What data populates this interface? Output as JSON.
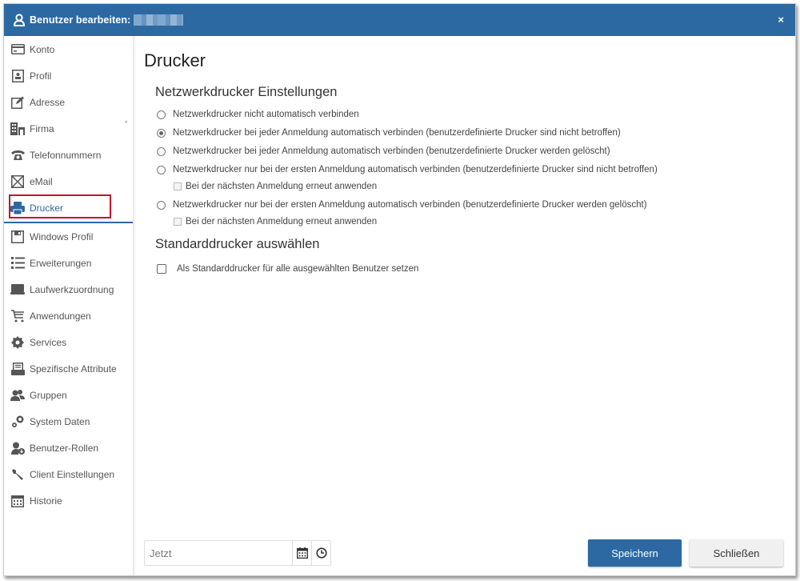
{
  "window": {
    "title": "Benutzer bearbeiten:",
    "title_icon": "user-icon",
    "close_label": "×"
  },
  "sidebar": {
    "items": [
      {
        "label": "Konto",
        "icon": "credit-card-icon"
      },
      {
        "label": "Profil",
        "icon": "profile-card-icon"
      },
      {
        "label": "Adresse",
        "icon": "edit-icon"
      },
      {
        "label": "Firma",
        "icon": "building-icon"
      },
      {
        "label": "Telefonnummern",
        "icon": "phone-icon"
      },
      {
        "label": "eMail",
        "icon": "envelope-icon"
      },
      {
        "label": "Drucker",
        "icon": "printer-icon",
        "active": true
      },
      {
        "label": "Windows Profil",
        "icon": "floppy-disk-icon"
      },
      {
        "label": "Erweiterungen",
        "icon": "list-icon"
      },
      {
        "label": "Laufwerkzuordnung",
        "icon": "drive-icon"
      },
      {
        "label": "Anwendungen",
        "icon": "cart-icon"
      },
      {
        "label": "Services",
        "icon": "gear-icon"
      },
      {
        "label": "Spezifische Attribute",
        "icon": "inbox-icon"
      },
      {
        "label": "Gruppen",
        "icon": "group-icon"
      },
      {
        "label": "System Daten",
        "icon": "gears-icon"
      },
      {
        "label": "Benutzer-Rollen",
        "icon": "user-role-icon"
      },
      {
        "label": "Client Einstellungen",
        "icon": "wrench-icon"
      },
      {
        "label": "Historie",
        "icon": "calendar-icon"
      }
    ],
    "firma_marker": "*"
  },
  "main": {
    "page_title": "Drucker",
    "network_section": {
      "title": "Netzwerkdrucker Einstellungen",
      "options": [
        {
          "label": "Netzwerkdrucker nicht automatisch verbinden",
          "checked": false
        },
        {
          "label": "Netzwerkdrucker bei jeder Anmeldung automatisch verbinden (benutzerdefinierte Drucker sind nicht betroffen)",
          "checked": true
        },
        {
          "label": "Netzwerkdrucker bei jeder Anmeldung automatisch verbinden (benutzerdefinierte Drucker werden gelöscht)",
          "checked": false
        },
        {
          "label": "Netzwerkdrucker nur bei der ersten Anmeldung automatisch verbinden (benutzerdefinierte Drucker sind nicht betroffen)",
          "checked": false,
          "sub_checkbox": {
            "label": "Bei der nächsten Anmeldung erneut anwenden",
            "checked": false,
            "disabled": true
          }
        },
        {
          "label": "Netzwerkdrucker nur bei der ersten Anmeldung automatisch verbinden (benutzerdefinierte Drucker werden gelöscht)",
          "checked": false,
          "sub_checkbox": {
            "label": "Bei der nächsten Anmeldung erneut anwenden",
            "checked": false,
            "disabled": true
          }
        }
      ]
    },
    "default_section": {
      "title": "Standarddrucker auswählen",
      "checkbox": {
        "label": "Als Standarddrucker für alle ausgewählten Benutzer setzen",
        "checked": false
      }
    }
  },
  "footer": {
    "date_placeholder": "Jetzt",
    "date_value": "",
    "calendar_icon": "calendar-icon",
    "clock_icon": "clock-icon",
    "save_label": "Speichern",
    "close_label": "Schließen"
  },
  "colors": {
    "accent": "#2c69a3",
    "selection_outline": "#c8102e"
  }
}
